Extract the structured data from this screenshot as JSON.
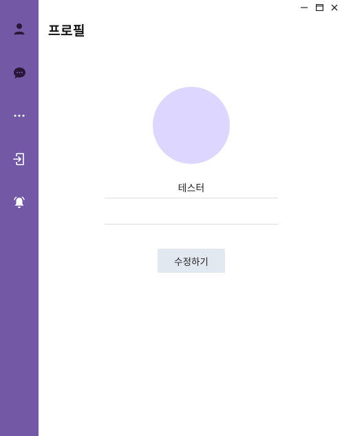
{
  "window_controls": {
    "minimize_icon": "minimize-icon",
    "maximize_icon": "maximize-icon",
    "close_icon": "close-icon"
  },
  "sidebar": {
    "background": "#7358a5",
    "icon_color": "#ffffff",
    "items": [
      {
        "icon": "person-icon",
        "active": true
      },
      {
        "icon": "chat-bubble-icon",
        "active": false
      },
      {
        "icon": "more-dots-icon",
        "active": false
      },
      {
        "icon": "logout-door-icon",
        "active": false
      },
      {
        "icon": "bell-icon",
        "active": false
      }
    ]
  },
  "main": {
    "title": "프로필",
    "avatar_color": "#ddd6fe",
    "name_value": "테스터",
    "status_value": "",
    "edit_button_label": "수정하기"
  }
}
